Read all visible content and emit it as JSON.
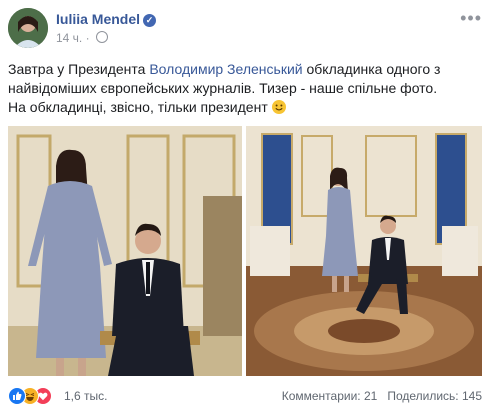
{
  "author": {
    "name": "Iuliia Mendel",
    "time": "14 ч."
  },
  "post": {
    "line1_a": "Завтра у Президента ",
    "line1_link": "Володимир Зеленський",
    "line1_b": " обкладинка одного з",
    "line2": "найвідоміших європейських журналів. Тизер - наше спільне фото.",
    "line3": "На обкладинці, звісно, тільки президент "
  },
  "icons": {
    "verified": "verified-badge-icon",
    "privacy": "globe-icon",
    "more": "more-options-icon"
  },
  "colors": {
    "link": "#385898",
    "like": "#1877f2",
    "love": "#f33e58",
    "haha": "#f7b125"
  },
  "reactions": {
    "count": "1,6 тыс."
  },
  "stats": {
    "comments": "Комментарии: 21",
    "shares": "Поделились: 145"
  }
}
